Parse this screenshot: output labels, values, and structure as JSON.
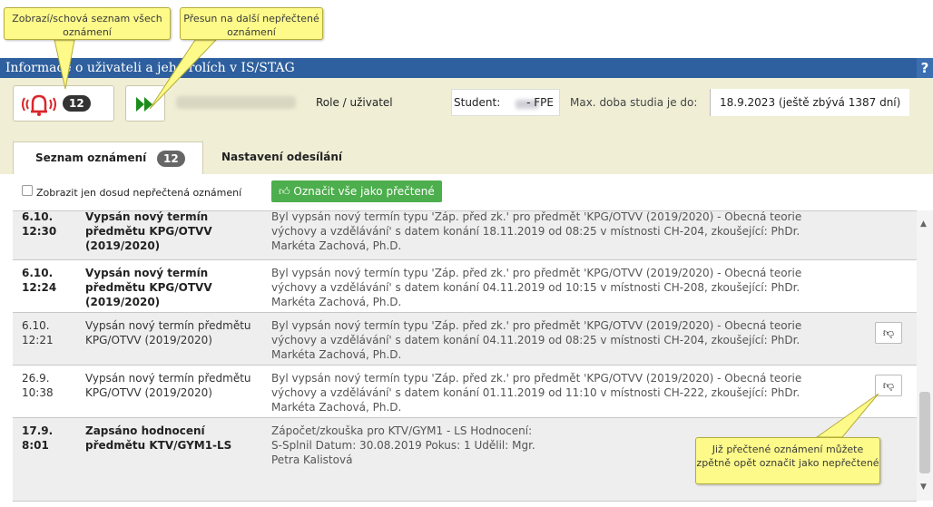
{
  "window": {
    "title": "Informace o uživateli a jeho rolích v IS/STAG",
    "help": "?"
  },
  "info": {
    "alarm_count": "12",
    "role_label": "Role / uživatel",
    "role_student": "Student:",
    "faculty": "- FPE",
    "max_label": "Max. doba studia je do:",
    "max_value": "18.9.2023 (ještě zbývá 1387 dní)"
  },
  "tabs": {
    "list_label": "Seznam oznámení",
    "list_count": "12",
    "settings_label": "Nastavení odesílání"
  },
  "filter": {
    "checkbox_label": "Zobrazit jen dosud nepřečtená oznámení",
    "mark_all": "Označit vše jako přečtené"
  },
  "rows": [
    {
      "date": "6.10. 12:30",
      "subject": "Vypsán nový termín předmětu KPG/OTVV (2019/2020)",
      "desc": "Byl vypsán nový termín typu 'Záp. před zk.' pro předmět 'KPG/OTVV (2019/2020) - Obecná teorie výchovy a vzdělávání' s datem konání 18.11.2019 od 08:25 v místnosti CH-204, zkoušející: PhDr. Markéta Zachová, Ph.D."
    },
    {
      "date": "6.10. 12:24",
      "subject": "Vypsán nový termín předmětu KPG/OTVV (2019/2020)",
      "desc": "Byl vypsán nový termín typu 'Záp. před zk.' pro předmět 'KPG/OTVV (2019/2020) - Obecná teorie výchovy a vzdělávání' s datem konání 04.11.2019 od 10:15 v místnosti CH-208, zkoušející: PhDr. Markéta Zachová, Ph.D."
    },
    {
      "date": "6.10. 12:21",
      "subject": "Vypsán nový termín předmětu KPG/OTVV (2019/2020)",
      "desc": "Byl vypsán nový termín typu 'Záp. před zk.' pro předmět 'KPG/OTVV (2019/2020) - Obecná teorie výchovy a vzdělávání' s datem konání 04.11.2019 od 08:25 v místnosti CH-204, zkoušející: PhDr. Markéta Zachová, Ph.D."
    },
    {
      "date": "26.9. 10:38",
      "subject": "Vypsán nový termín předmětu KPG/OTVV (2019/2020)",
      "desc": "Byl vypsán nový termín typu 'Záp. před zk.' pro předmět 'KPG/OTVV (2019/2020) - Obecná teorie výchovy a vzdělávání' s datem konání 01.11.2019 od 11:10 v místnosti CH-222, zkoušející: PhDr. Markéta Zachová, Ph.D."
    },
    {
      "date": "17.9. 8:01",
      "subject": "Zapsáno hodnocení předmětu KTV/GYM1-LS",
      "desc": "Zápočet/zkouška pro KTV/GYM1 - LS Hodnocení: S-Splnil Datum: 30.08.2019 Pokus: 1 Udělil: Mgr. Petra Kalistová"
    }
  ],
  "tooltips": {
    "toggle": "Zobrazí/schová seznam všech oznámení",
    "next": "Přesun na další nepřečtené oznámení",
    "unread": "Již přečtené oznámení můžete zpětně opět označit jako nepřečtené"
  },
  "colors": {
    "titlebar": "#2e5f9e",
    "infobar": "#f0efd6",
    "button_green": "#4cae4c",
    "tooltip": "#fdfa8a",
    "alarm_red": "#d9262b",
    "next_green": "#1a8d1a"
  },
  "icons": {
    "alarm": "bell-alarm-icon",
    "next": "fast-forward-icon",
    "mark_all": "thumbs-up-icon",
    "mark_unread": "thumbs-down-icon"
  }
}
